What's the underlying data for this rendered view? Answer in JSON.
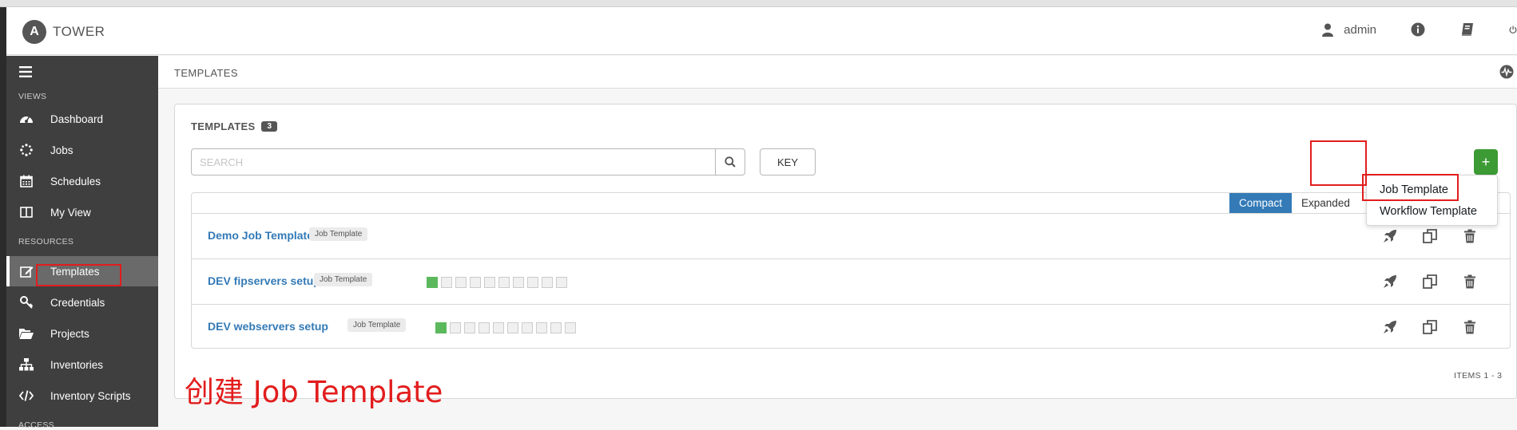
{
  "app": {
    "logo_letter": "A",
    "logo_text": "TOWER"
  },
  "header": {
    "username": "admin"
  },
  "sidebar": {
    "sections": [
      "VIEWS",
      "RESOURCES",
      "ACCESS"
    ],
    "views": [
      {
        "label": "Dashboard",
        "icon": "dashboard-icon"
      },
      {
        "label": "Jobs",
        "icon": "spinner-icon"
      },
      {
        "label": "Schedules",
        "icon": "calendar-icon"
      },
      {
        "label": "My View",
        "icon": "columns-icon"
      }
    ],
    "resources": [
      {
        "label": "Templates",
        "icon": "edit-icon",
        "active": true
      },
      {
        "label": "Credentials",
        "icon": "key-icon"
      },
      {
        "label": "Projects",
        "icon": "folder-icon"
      },
      {
        "label": "Inventories",
        "icon": "sitemap-icon"
      },
      {
        "label": "Inventory Scripts",
        "icon": "code-icon"
      }
    ]
  },
  "breadcrumb": {
    "title": "TEMPLATES"
  },
  "panel": {
    "title": "TEMPLATES",
    "count": "3",
    "search_placeholder": "SEARCH",
    "key_label": "KEY",
    "add_label": "+",
    "view_toggle": {
      "compact": "Compact",
      "expanded": "Expanded"
    },
    "items_label": "ITEMS  1 - 3"
  },
  "templates": [
    {
      "name": "Demo Job Template",
      "type": "Job Template",
      "recent_jobs": []
    },
    {
      "name": "DEV fipservers setup",
      "type": "Job Template",
      "recent_jobs": [
        "success",
        "none",
        "none",
        "none",
        "none",
        "none",
        "none",
        "none",
        "none",
        "none"
      ]
    },
    {
      "name": "DEV webservers setup",
      "type": "Job Template",
      "recent_jobs": [
        "success",
        "none",
        "none",
        "none",
        "none",
        "none",
        "none",
        "none",
        "none",
        "none"
      ]
    }
  ],
  "add_menu": [
    "Job Template",
    "Workflow Template"
  ],
  "annotation": {
    "caption": "创建 Job Template"
  },
  "colors": {
    "sidebar": "#3f3f3f",
    "link": "#337ab7",
    "add_button": "#3d9b35",
    "highlight": "#e21d1d",
    "success": "#5cb85c"
  }
}
